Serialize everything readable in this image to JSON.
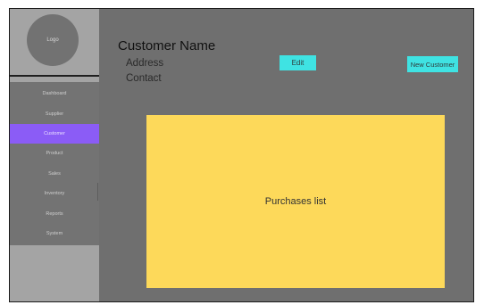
{
  "sidebar": {
    "logo_label": "Logo",
    "items": [
      {
        "label": "Dashboard"
      },
      {
        "label": "Supplier"
      },
      {
        "label": "Customer",
        "active": true
      },
      {
        "label": "Product"
      },
      {
        "label": "Sales"
      },
      {
        "label": "Inventory"
      },
      {
        "label": "Reports"
      },
      {
        "label": "System"
      }
    ]
  },
  "customer": {
    "name": "Customer Name",
    "address": "Address",
    "contact": "Contact"
  },
  "buttons": {
    "edit_label": "Edit",
    "new_customer_label": "New Customer"
  },
  "purchases": {
    "label": "Purchases list"
  },
  "colors": {
    "background": "#6f6f6f",
    "sidebar_panel": "#a4a4a4",
    "active_nav": "#8b5cf6",
    "button": "#3fe3e3",
    "purchases_panel": "#fdd95a"
  }
}
